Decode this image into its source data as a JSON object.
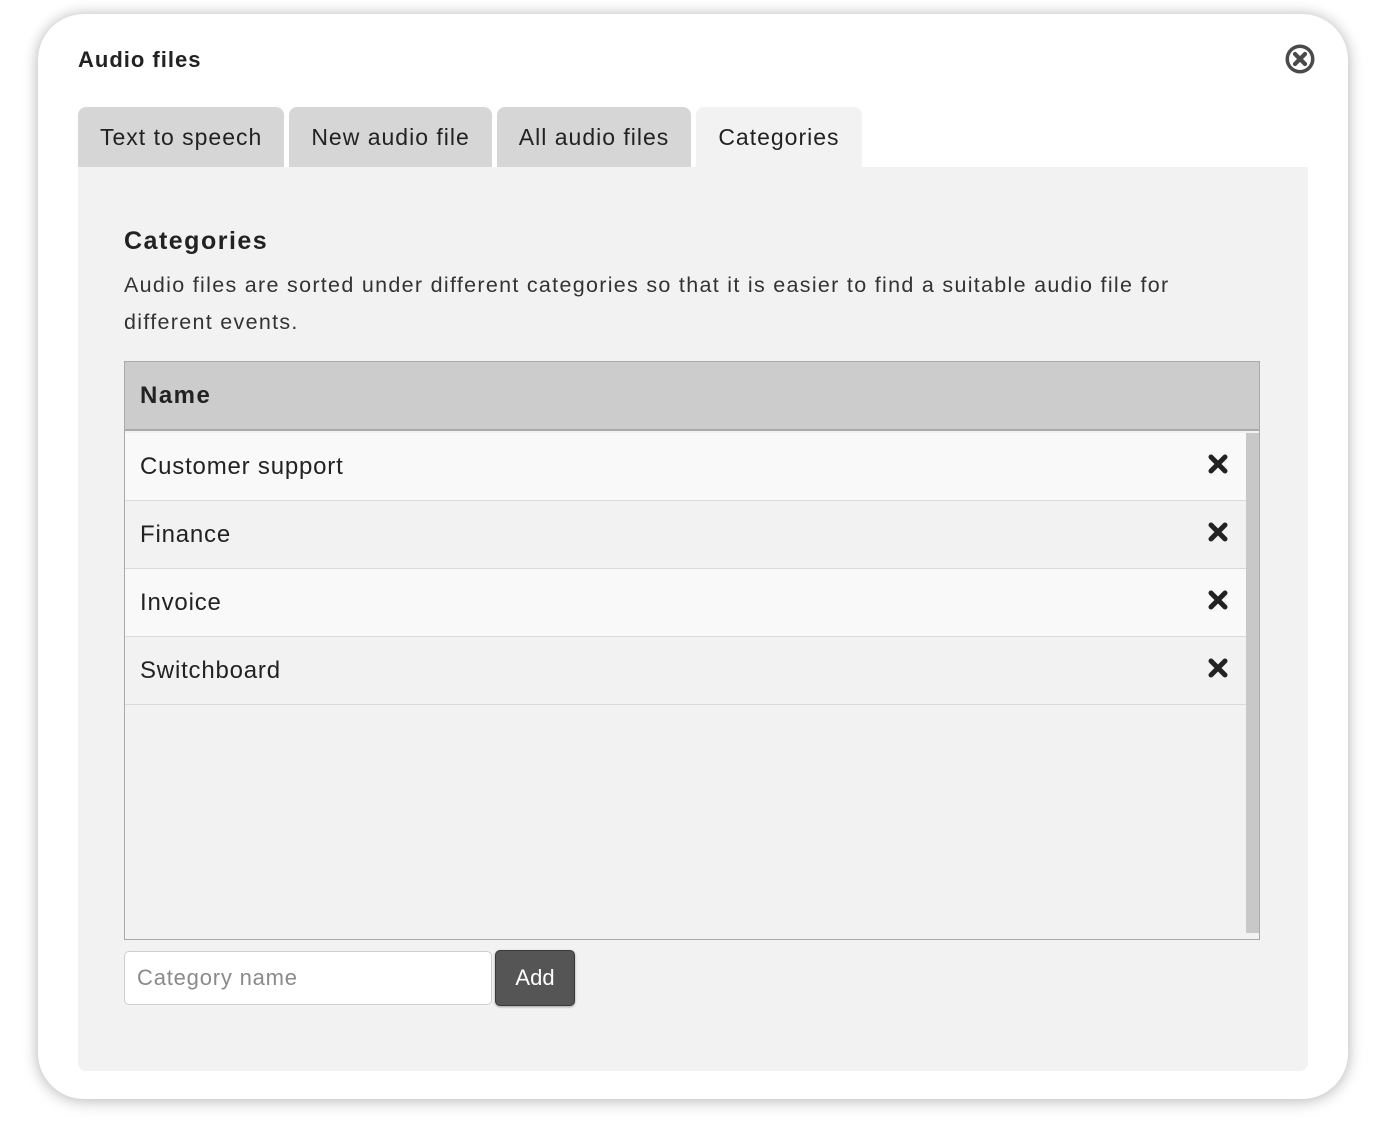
{
  "dialog": {
    "title": "Audio files"
  },
  "tabs": [
    {
      "label": "Text to speech",
      "active": false
    },
    {
      "label": "New audio file",
      "active": false
    },
    {
      "label": "All audio files",
      "active": false
    },
    {
      "label": "Categories",
      "active": true
    }
  ],
  "section": {
    "heading": "Categories",
    "description": "Audio files are sorted under different categories so that it is easier to find a suitable audio file for different events."
  },
  "table": {
    "column_header": "Name",
    "rows": [
      {
        "name": "Customer support"
      },
      {
        "name": "Finance"
      },
      {
        "name": "Invoice"
      },
      {
        "name": "Switchboard"
      }
    ]
  },
  "add_form": {
    "input_value": "",
    "input_placeholder": "Category name",
    "button_label": "Add"
  },
  "icons": {
    "close": "close-circle-icon",
    "row_delete": "delete-x-icon"
  },
  "colors": {
    "panel_bg": "#f2f2f2",
    "tab_inactive": "#d6d6d6",
    "header_bg": "#cccccc",
    "button_bg": "#555555"
  }
}
